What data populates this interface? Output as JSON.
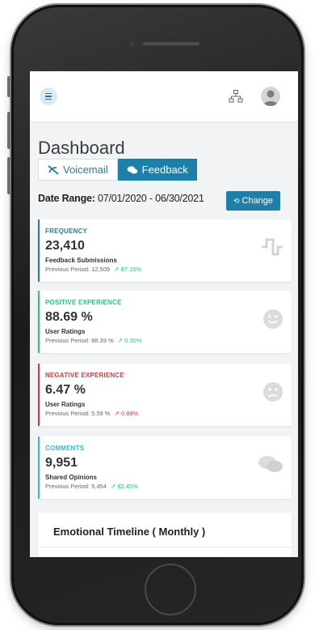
{
  "header": {
    "menu_icon": "hamburger-icon",
    "sitemap_icon": "sitemap-icon",
    "avatar_icon": "user-avatar-icon"
  },
  "dashboard": {
    "title": "Dashboard",
    "tabs": [
      {
        "label": "Voicemail",
        "icon": "phone-slash-icon",
        "active": false
      },
      {
        "label": "Feedback",
        "icon": "comments-icon",
        "active": true
      }
    ],
    "date_range_label": "Date Range:",
    "date_range_value": "07/01/2020 - 06/30/2021",
    "change_label": "Change"
  },
  "cards": [
    {
      "label": "FREQUENCY",
      "value": "23,410",
      "sub": "Feedback Submissions",
      "prev": "Previous Period: 12,509",
      "change": "87.15%",
      "accent": "#1f7fa7",
      "change_color": "#2ec27e",
      "icon": "wave-pulse-icon"
    },
    {
      "label": "POSITIVE EXPERIENCE",
      "value": "88.69 %",
      "sub": "User Ratings",
      "prev": "Previous Period: 88.39 %",
      "change": "0.30%",
      "accent": "#2ec27e",
      "change_color": "#2ec27e",
      "icon": "smile-icon"
    },
    {
      "label": "NEGATIVE EXPERIENCE",
      "value": "6.47 %",
      "sub": "User Ratings",
      "prev": "Previous Period: 5.59 %",
      "change": "0.88%",
      "accent": "#d9363e",
      "change_color": "#d9363e",
      "icon": "frown-icon"
    },
    {
      "label": "COMMENTS",
      "value": "9,951",
      "sub": "Shared Opinions",
      "prev": "Previous Period: 5,454",
      "change": "82.45%",
      "accent": "#36b9cc",
      "change_color": "#2ec27e",
      "icon": "comments-icon"
    }
  ],
  "timeline": {
    "title": "Emotional Timeline ( Monthly )"
  }
}
